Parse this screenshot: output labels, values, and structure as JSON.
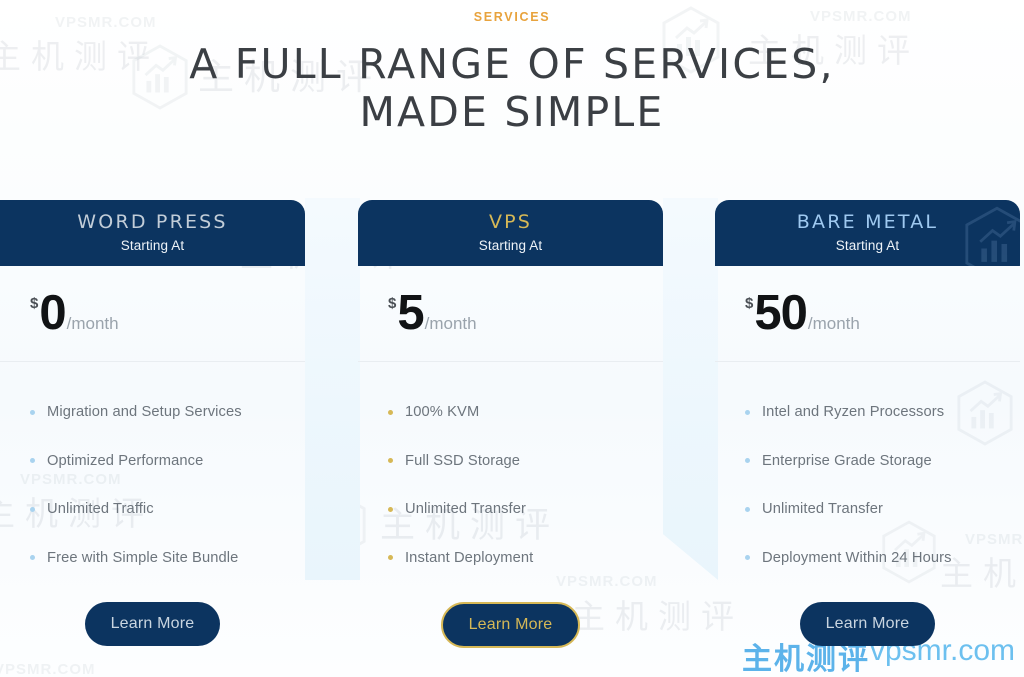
{
  "header": {
    "eyebrow": "SERVICES",
    "headline_line1": "A FULL RANGE OF SERVICES,",
    "headline_line2": "MADE SIMPLE"
  },
  "colors": {
    "navy": "#0c3460",
    "gold": "#d6b856",
    "eyebrow_orange": "#e8a33d",
    "light_blue": "#9fc9f0",
    "bullet_blue": "#a9d3ef",
    "page_bg": "#f6fafd"
  },
  "plans": [
    {
      "name": "WORD PRESS",
      "starting_label": "Starting At",
      "currency": "$",
      "amount": "0",
      "period": "/month",
      "accent": "blue",
      "featured": false,
      "features": [
        "Migration and Setup Services",
        "Optimized Performance",
        "Unlimited Traffic",
        "Free with Simple Site Bundle"
      ],
      "cta": "Learn More"
    },
    {
      "name": "VPS",
      "starting_label": "Starting At",
      "currency": "$",
      "amount": "5",
      "period": "/month",
      "accent": "gold",
      "featured": true,
      "features": [
        "100% KVM",
        "Full SSD Storage",
        "Unlimited Transfer",
        "Instant Deployment"
      ],
      "cta": "Learn More"
    },
    {
      "name": "BARE METAL",
      "starting_label": "Starting At",
      "currency": "$",
      "amount": "50",
      "period": "/month",
      "accent": "blue",
      "featured": false,
      "features": [
        "Intel and Ryzen Processors",
        "Enterprise Grade Storage",
        "Unlimited Transfer",
        "Deployment Within 24 Hours"
      ],
      "cta": "Learn More"
    }
  ],
  "watermarks": {
    "site_en": "VPSMR.COM",
    "site_cn": "主机测评",
    "brand_cn": "主机测评",
    "brand_en": "vpsmr.com"
  }
}
